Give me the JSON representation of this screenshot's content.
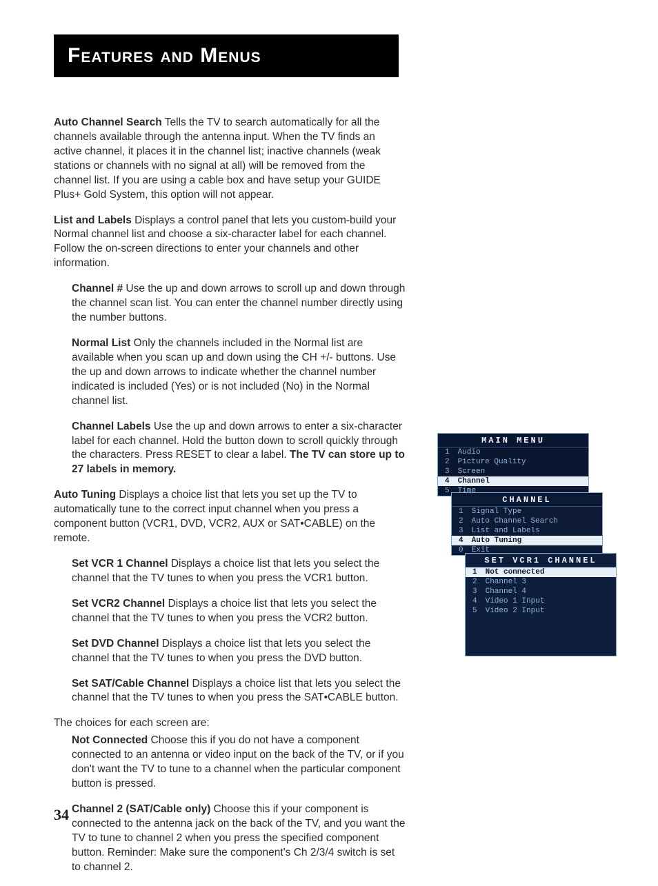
{
  "page_number": "34",
  "banner": "Features and Menus",
  "paragraphs": {
    "acs": {
      "term": "Auto Channel Search",
      "body": "  Tells the TV to search automatically for all the channels available through the antenna input. When the TV finds an active channel, it places it in the channel list; inactive channels (weak stations or channels with no signal at all) will be removed from the channel list. If you are using a cable box and have setup your GUIDE Plus+ Gold System, this option will not appear."
    },
    "ll": {
      "term": "List and Labels",
      "body": "   Displays a control panel that lets you custom-build your Normal channel list and choose a six-character label for each channel. Follow the on-screen directions to enter your channels and other information."
    },
    "chn": {
      "term": "Channel #",
      "body": "   Use the up and down arrows to scroll up and down through the channel scan list. You can enter the channel number directly using the number buttons."
    },
    "nl": {
      "term": "Normal List",
      "body": "   Only the channels included in the Normal list are available when you scan up and down using the CH +/- buttons. Use the up and down arrows to indicate whether the channel number indicated is included (Yes) or is not included (No) in the Normal channel list."
    },
    "cl": {
      "term": "Channel Labels",
      "body_a": "   Use the up and down arrows to enter a six-character label for each channel. Hold the button down to scroll quickly through the characters. Press RESET to clear a label. ",
      "body_b": "The TV can store up to 27 labels in memory."
    },
    "at": {
      "term": "Auto Tuning",
      "body": "  Displays a choice list that lets you set up the TV to automatically tune to the correct input channel when you press a component button (VCR1, DVD, VCR2, AUX or SAT•CABLE) on the remote."
    },
    "v1": {
      "term": "Set VCR 1 Channel",
      "body": "  Displays a choice list that lets you select the channel that the TV tunes to when you press the VCR1 button."
    },
    "v2": {
      "term": "Set VCR2 Channel",
      "body": "  Displays a choice list that lets you select the channel that the TV tunes to when you press the VCR2 button."
    },
    "dvd": {
      "term": "Set DVD Channel",
      "body": "  Displays a choice list that lets you select the channel that the TV tunes to when you press the DVD button."
    },
    "sat": {
      "term": "Set SAT/Cable Channel",
      "body": "  Displays a choice list that lets you select the channel that the TV tunes to when you press the SAT•CABLE button."
    },
    "choices_lead": "The choices for each screen are:",
    "nc": {
      "term": "Not Connected",
      "body": "  Choose this if you do not have a component connected to an antenna or video input on the back of the TV, or if you don't want the TV to tune to a channel when the particular component button is pressed."
    },
    "c2": {
      "term": "Channel 2 (SAT/Cable only)",
      "body": "  Choose this if your component is connected to the antenna jack on the back of the TV, and you want the TV to tune to channel 2 when you press the specified component button. Reminder: Make sure the component's Ch 2/3/4 switch is set to channel 2."
    }
  },
  "menus": {
    "main": {
      "title": "MAIN MENU",
      "items": [
        {
          "n": "1",
          "label": "Audio",
          "sel": false
        },
        {
          "n": "2",
          "label": "Picture Quality",
          "sel": false
        },
        {
          "n": "3",
          "label": "Screen",
          "sel": false
        },
        {
          "n": "4",
          "label": "Channel",
          "sel": true
        },
        {
          "n": "5",
          "label": "Time",
          "sel": false
        }
      ]
    },
    "channel": {
      "title": "CHANNEL",
      "items": [
        {
          "n": "1",
          "label": "Signal Type",
          "sel": false
        },
        {
          "n": "2",
          "label": "Auto Channel Search",
          "sel": false
        },
        {
          "n": "3",
          "label": "List and Labels",
          "sel": false
        },
        {
          "n": "4",
          "label": "Auto Tuning",
          "sel": true
        },
        {
          "n": "0",
          "label": "Exit",
          "sel": false
        }
      ]
    },
    "vcr1": {
      "title": "SET VCR1 CHANNEL",
      "items": [
        {
          "n": "1",
          "label": "Not connected",
          "sel": true
        },
        {
          "n": "2",
          "label": "Channel 3",
          "sel": false
        },
        {
          "n": "3",
          "label": "Channel 4",
          "sel": false
        },
        {
          "n": "4",
          "label": "Video 1 Input",
          "sel": false
        },
        {
          "n": "5",
          "label": "Video 2 Input",
          "sel": false
        }
      ]
    }
  }
}
